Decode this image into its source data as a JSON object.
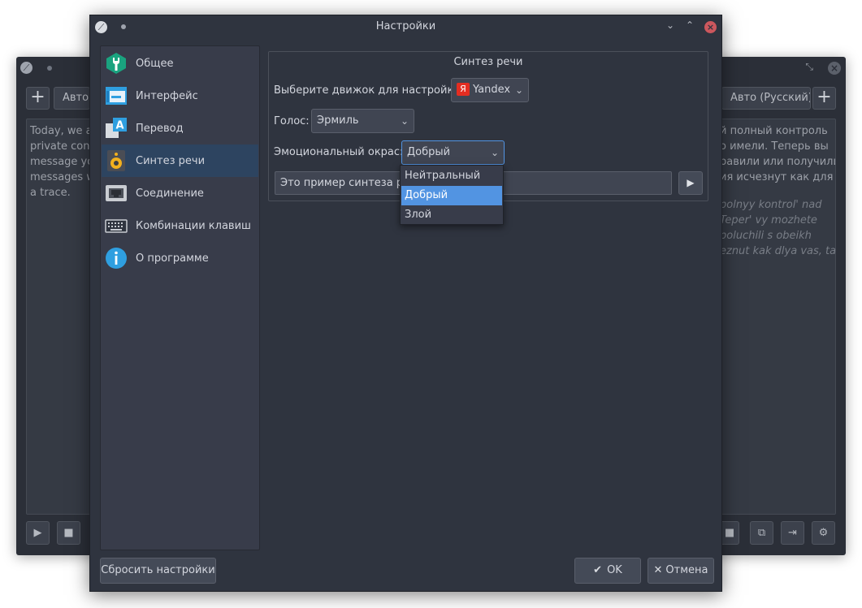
{
  "background_window": {
    "add_left_label": "+",
    "add_right_label": "+",
    "source_lang_tab": "Авто (",
    "target_lang_tab": "Авто (Русский)",
    "source_text_lines": [
      "Today, we ar",
      "private conv",
      "message you",
      "messages wi",
      "a trace."
    ],
    "translation_lines": [
      "й полный контроль",
      "о имели. Теперь вы",
      "равили или получили",
      "ия исчезнут как для"
    ],
    "translit_lines": [
      "polnyy kontrol' nad",
      "Teper' vy mozhete",
      "poluchili s obeikh",
      "eznut kak dlya vas, tak"
    ],
    "icons": {
      "app": "app-logo-icon",
      "play": "▶",
      "stop": "■",
      "copy": "⧉",
      "export": "⇥",
      "settings": "⚙"
    }
  },
  "dialog": {
    "title": "Настройки",
    "controls": {
      "collapse": "⌄",
      "expand": "⌃",
      "close": "×"
    },
    "sidebar": {
      "items": [
        {
          "label": "Общее",
          "icon": "wrench-icon"
        },
        {
          "label": "Интерфейс",
          "icon": "interface-icon"
        },
        {
          "label": "Перевод",
          "icon": "translate-icon"
        },
        {
          "label": "Синтез речи",
          "icon": "speaker-icon",
          "active": true
        },
        {
          "label": "Соединение",
          "icon": "network-icon"
        },
        {
          "label": "Комбинации клавиш",
          "icon": "keyboard-icon"
        },
        {
          "label": "О программе",
          "icon": "info-icon"
        }
      ]
    },
    "tts": {
      "group_title": "Синтез речи",
      "engine_label": "Выберите движок для настройки:",
      "engine_badge": "Я",
      "engine_value": "Yandex",
      "voice_label": "Голос:",
      "voice_value": "Эрмиль",
      "emotion_label": "Эмоциональный окрас:",
      "emotion_value": "Добрый",
      "emotion_options": [
        "Нейтральный",
        "Добрый",
        "Злой"
      ],
      "emotion_selected": "Добрый",
      "sample_text": "Это пример синтеза речи.",
      "play_label": "▶"
    },
    "buttons": {
      "reset": "Сбросить настройки",
      "ok": "OK",
      "ok_icon": "✔",
      "cancel": "Отмена",
      "cancel_icon": "✕"
    }
  },
  "colors": {
    "accent": "#5294e2",
    "active_sidebar": "#2d4460",
    "close_button": "#cc575d",
    "yandex_red": "#e42d21"
  }
}
